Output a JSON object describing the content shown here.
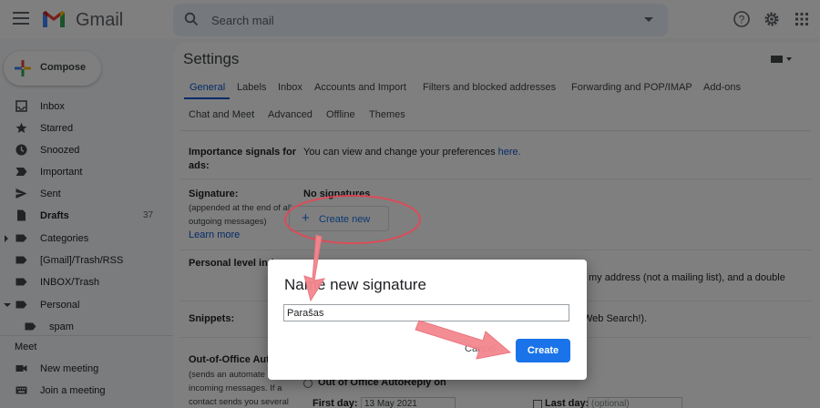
{
  "app": {
    "brand": "Gmail",
    "search_placeholder": "Search mail",
    "logo_colors": {
      "blue": "#4285f4",
      "red": "#ea4335",
      "yellow": "#fbbc04",
      "green": "#34a853"
    }
  },
  "sidebar": {
    "compose_label": "Compose",
    "items": [
      {
        "label": "Inbox",
        "icon": "inbox-icon"
      },
      {
        "label": "Starred",
        "icon": "star-icon"
      },
      {
        "label": "Snoozed",
        "icon": "clock-icon"
      },
      {
        "label": "Important",
        "icon": "important-icon"
      },
      {
        "label": "Sent",
        "icon": "send-icon"
      },
      {
        "label": "Drafts",
        "icon": "draft-icon",
        "count": "37"
      },
      {
        "label": "Categories",
        "icon": "label-icon"
      },
      {
        "label": "[Gmail]/Trash/RSS",
        "icon": "label-icon"
      },
      {
        "label": "INBOX/Trash",
        "icon": "label-icon"
      },
      {
        "label": "Personal",
        "icon": "label-icon"
      },
      {
        "label": "spam",
        "icon": "label-icon"
      }
    ],
    "meet": {
      "heading": "Meet",
      "items": [
        {
          "label": "New meeting",
          "icon": "video-icon"
        },
        {
          "label": "Join a meeting",
          "icon": "keyboard-icon"
        }
      ]
    }
  },
  "settings": {
    "title": "Settings",
    "tabs_row1": [
      "General",
      "Labels",
      "Inbox",
      "Accounts and Import",
      "Filters and blocked addresses",
      "Forwarding and POP/IMAP",
      "Add-ons"
    ],
    "tabs_row2": [
      "Chat and Meet",
      "Advanced",
      "Offline",
      "Themes"
    ],
    "active_tab": "General",
    "importance": {
      "label_line1": "Importance signals for",
      "label_line2": "ads:",
      "value_prefix": "You can view and change your preferences",
      "value_link": "here."
    },
    "signature": {
      "label": "Signature:",
      "sub_line1": "(appended at the end of all",
      "sub_line2": "outgoing messages)",
      "learn_more": "Learn more",
      "no_signatures": "No signatures",
      "create_new": "Create new"
    },
    "personal_level": {
      "label": "Personal level ind",
      "value_line1": "my address (not a mailing list), and a double"
    },
    "snippets": {
      "label": "Snippets:",
      "value_tail": "Web Search!)."
    },
    "out_of_office": {
      "label": "Out-of-Office Auto",
      "sub_line1": "(sends an automate",
      "sub_line2": "incoming messages. If a",
      "sub_line3": "contact sends you several",
      "radio_on": "Out of Office AutoReply on",
      "first_day_label": "First day:",
      "first_day_value": "13 May 2021",
      "last_day_label": "Last day:",
      "last_day_placeholder": "(optional)"
    }
  },
  "dialog": {
    "title": "Name new signature",
    "input_value": "Parašas",
    "cancel": "Cancel",
    "create": "Create"
  },
  "annotation_color": "#f4868e"
}
